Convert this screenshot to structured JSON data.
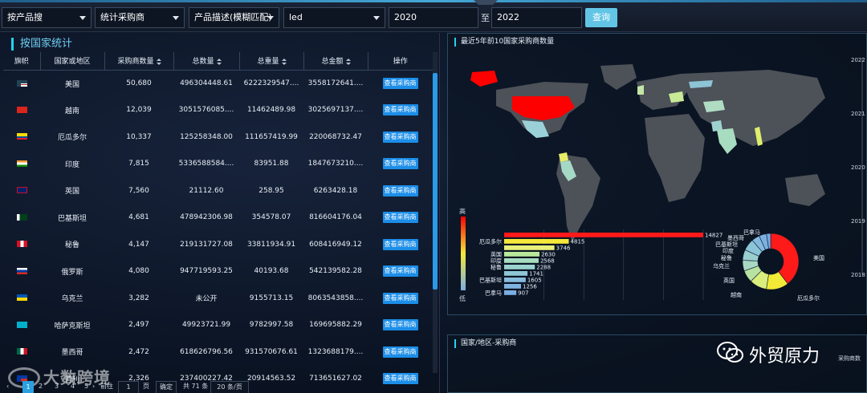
{
  "filters": {
    "product_search": "按产品搜",
    "buyer_stat": "统计采购商",
    "desc_mode": "产品描述(模糊匹配)",
    "keyword": "led",
    "year_from": "2020",
    "to_label": "至",
    "year_to": "2022",
    "query_button": "查询"
  },
  "left": {
    "title": "按国家统计",
    "headers": [
      "旗帜",
      "国家或地区",
      "采购商数量",
      "总数量",
      "总重量",
      "总金额",
      "操作"
    ],
    "view_label": "查看采购商",
    "rows": [
      {
        "country": "美国",
        "buyers": "50,680",
        "qty": "496304448.61",
        "weight": "6222329547....",
        "amount": "3558172641...."
      },
      {
        "country": "越南",
        "buyers": "12,039",
        "qty": "3051576085....",
        "weight": "11462489.98",
        "amount": "3025697137...."
      },
      {
        "country": "厄瓜多尔",
        "buyers": "10,337",
        "qty": "125258348.00",
        "weight": "111657419.99",
        "amount": "220068732.47"
      },
      {
        "country": "印度",
        "buyers": "7,815",
        "qty": "5336588584....",
        "weight": "83951.88",
        "amount": "1847673210...."
      },
      {
        "country": "英国",
        "buyers": "7,560",
        "qty": "21112.60",
        "weight": "258.95",
        "amount": "6263428.18"
      },
      {
        "country": "巴基斯坦",
        "buyers": "4,681",
        "qty": "478942306.98",
        "weight": "354578.07",
        "amount": "816604176.04"
      },
      {
        "country": "秘鲁",
        "buyers": "4,147",
        "qty": "219131727.08",
        "weight": "33811934.91",
        "amount": "608416949.12"
      },
      {
        "country": "俄罗斯",
        "buyers": "4,080",
        "qty": "947719593.25",
        "weight": "40193.68",
        "amount": "542139582.28"
      },
      {
        "country": "乌克兰",
        "buyers": "3,282",
        "qty": "未公开",
        "weight": "9155713.15",
        "amount": "8063543858...."
      },
      {
        "country": "哈萨克斯坦",
        "buyers": "2,497",
        "qty": "49923721.99",
        "weight": "9782997.58",
        "amount": "169695882.29"
      },
      {
        "country": "墨西哥",
        "buyers": "2,472",
        "qty": "618626796.56",
        "weight": "931570676.61",
        "amount": "1323688179...."
      },
      {
        "country": "智利",
        "buyers": "2,326",
        "qty": "237400227.42",
        "weight": "20914563.52",
        "amount": "713651627.02"
      }
    ],
    "pager": {
      "pages": [
        "1",
        "2",
        "3",
        "4",
        "5"
      ],
      "goto": "前往",
      "page_input": "1",
      "page_word": "页",
      "confirm": "确定",
      "total": "共 71 条",
      "per_page": "20 条/页"
    }
  },
  "watermark_left": "大数跨境",
  "map": {
    "title": "最近5年前10国家采购商数量",
    "legend_high": "高",
    "legend_low": "低",
    "years": [
      "2022",
      "2021",
      "2020",
      "2019",
      "2018"
    ]
  },
  "chart_data": [
    {
      "type": "bar",
      "title": "",
      "categories": [
        "美国",
        "厄瓜多尔",
        "越南",
        "英国",
        "印度",
        "秘鲁",
        "巴基斯坦",
        "墨西哥",
        "俄罗斯",
        "巴拿马"
      ],
      "shown_labels": [
        "",
        "厄瓜多尔",
        "",
        "英国",
        "印度",
        "秘鲁",
        "",
        "巴基斯坦",
        "",
        "巴拿马"
      ],
      "values": [
        14827,
        4815,
        3746,
        2630,
        2568,
        2288,
        1741,
        1605,
        1256,
        907
      ],
      "colors": [
        "#ff1a1a",
        "#f5e83a",
        "#e8f07a",
        "#b9e89a",
        "#a8dcc0",
        "#9bd2cf",
        "#8fc6d6",
        "#86bcdc",
        "#7fb4e0",
        "#7aaee3"
      ]
    },
    {
      "type": "pie",
      "title": "",
      "labels": [
        "美国",
        "厄瓜多尔",
        "越南",
        "英国",
        "乌克兰",
        "秘鲁",
        "印度",
        "巴基斯坦",
        "墨西哥",
        "巴拿马"
      ],
      "values": [
        14827,
        4815,
        3746,
        2630,
        2300,
        2288,
        2568,
        1741,
        1605,
        907
      ],
      "colors": [
        "#ff1a1a",
        "#f2ea36",
        "#d9ee7c",
        "#b8e2a2",
        "#a9d8c2",
        "#9acfd0",
        "#8cc4d8",
        "#84bade",
        "#7cb0e2",
        "#76a8e6"
      ]
    }
  ],
  "panel2": {
    "title": "国家/地区-采购商",
    "tiny": "采购商数"
  },
  "wechat": {
    "text": "外贸原力"
  }
}
